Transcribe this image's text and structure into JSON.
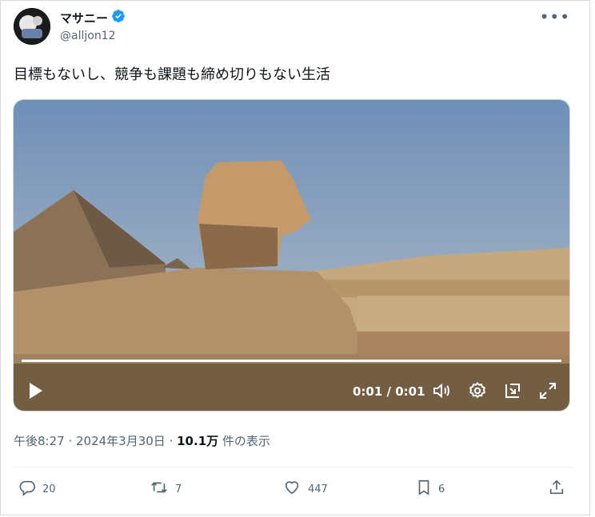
{
  "user": {
    "display_name": "マサニー",
    "handle": "@alljon12"
  },
  "tweet": {
    "text": "目標もないし、競争も課題も締め切りもない生活"
  },
  "video": {
    "time_display": "0:01 / 0:01",
    "progress": 1.0,
    "icons": [
      "play-icon",
      "volume-icon",
      "settings-icon",
      "picture-in-picture-icon",
      "fullscreen-icon"
    ]
  },
  "meta": {
    "time": "午後8:27",
    "separator1": " · ",
    "date": "2024年3月30日",
    "separator2": " · ",
    "views": "10.1万",
    "views_label": " 件の表示"
  },
  "actions": {
    "replies": "20",
    "retweets": "7",
    "likes": "447",
    "bookmarks": "6"
  },
  "colors": {
    "verified": "#1d9bf0",
    "secondary_text": "#536471"
  }
}
